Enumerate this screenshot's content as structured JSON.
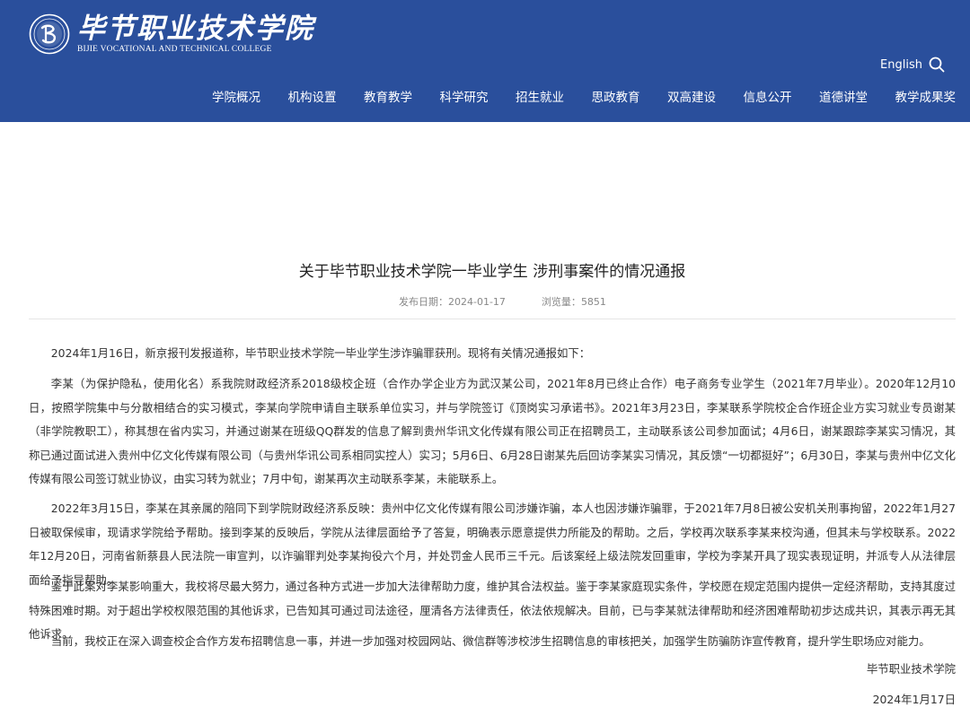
{
  "header": {
    "logo_cn": "毕节职业技术学院",
    "logo_en": "BIJIE VOCATIONAL AND TECHNICAL COLLEGE",
    "language_link": "English",
    "brand_color": "#2a4f9c",
    "search_icon": "search-icon"
  },
  "nav": {
    "items": [
      "学院概况",
      "机构设置",
      "教育教学",
      "科学研究",
      "招生就业",
      "思政教育",
      "双高建设",
      "信息公开",
      "道德讲堂",
      "教学成果奖"
    ]
  },
  "article": {
    "title": "关于毕节职业技术学院一毕业学生 涉刑事案件的情况通报",
    "publish_label": "发布日期：",
    "publish_date": "2024-01-17",
    "views_label": "浏览量：",
    "views": "5851",
    "paragraphs": [
      "2024年1月16日，新京报刊发报道称，毕节职业技术学院一毕业学生涉诈骗罪获刑。现将有关情况通报如下：",
      "李某（为保护隐私，使用化名）系我院财政经济系2018级校企班（合作办学企业方为武汉某公司，2021年8月已终止合作）电子商务专业学生（2021年7月毕业）。2020年12月10日，按照学院集中与分散相结合的实习模式，李某向学院申请自主联系单位实习，并与学院签订《顶岗实习承诺书》。2021年3月23日，李某联系学院校企合作班企业方实习就业专员谢某（非学院教职工），称其想在省内实习，并通过谢某在班级QQ群发的信息了解到贵州华讯文化传媒有限公司正在招聘员工，主动联系该公司参加面试；4月6日，谢某跟踪李某实习情况，其称已通过面试进入贵州中亿文化传媒有限公司（与贵州华讯公司系相同实控人）实习；5月6日、6月28日谢某先后回访李某实习情况，其反馈“一切都挺好”；6月30日，李某与贵州中亿文化传媒有限公司签订就业协议，由实习转为就业；7月中旬，谢某再次主动联系李某，未能联系上。",
      "2022年3月15日，李某在其亲属的陪同下到学院财政经济系反映：贵州中亿文化传媒有限公司涉嫌诈骗，本人也因涉嫌诈骗罪，于2021年7月8日被公安机关刑事拘留，2022年1月27日被取保候审，现请求学院给予帮助。接到李某的反映后，学院从法律层面给予了答复，明确表示愿意提供力所能及的帮助。之后，学校再次联系李某来校沟通，但其未与学校联系。2022年12月20日，河南省新蔡县人民法院一审宣判，以诈骗罪判处李某拘役六个月，并处罚金人民币三千元。后该案经上级法院发回重审，学校为李某开具了现实表现证明，并派专人从法律层面给予指导帮助。",
      "鉴于此案对李某影响重大，我校将尽最大努力，通过各种方式进一步加大法律帮助力度，维护其合法权益。鉴于李某家庭现实条件，学校愿在规定范围内提供一定经济帮助，支持其度过特殊困难时期。对于超出学校权限范围的其他诉求，已告知其可通过司法途径，厘清各方法律责任，依法依规解决。目前，已与李某就法律帮助和经济困难帮助初步达成共识，其表示再无其他诉求。",
      "当前，我校正在深入调查校企合作方发布招聘信息一事，并进一步加强对校园网站、微信群等涉校涉生招聘信息的审核把关，加强学生防骗防诈宣传教育，提升学生职场应对能力。"
    ],
    "signature_org": "毕节职业技术学院",
    "signature_date": "2024年1月17日"
  }
}
